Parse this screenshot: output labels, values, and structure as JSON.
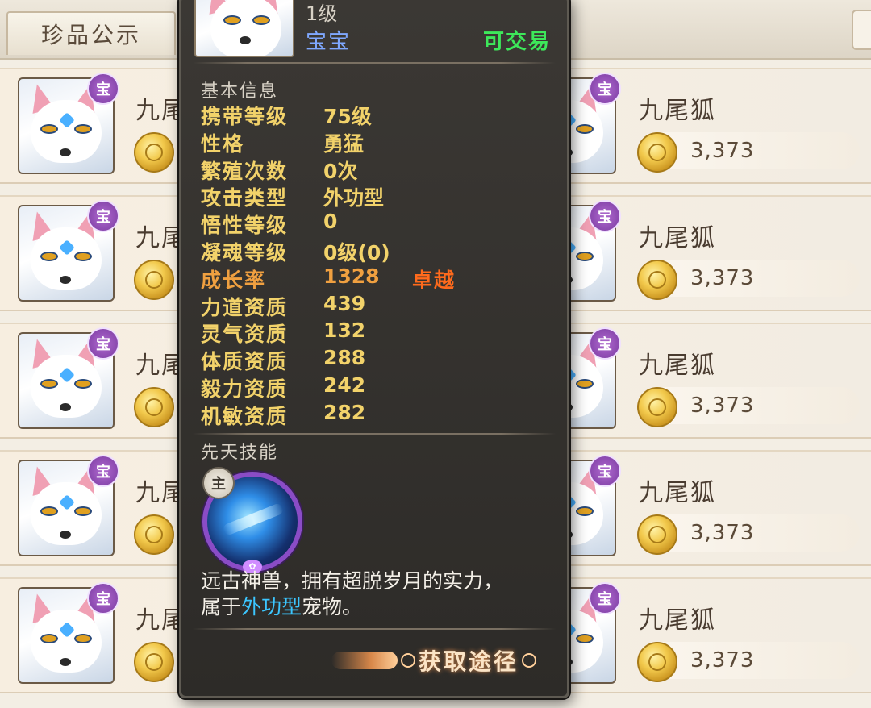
{
  "topbar": {
    "tab_label": "珍品公示"
  },
  "listings": [
    {
      "name": "九尾狐",
      "price": "3,373",
      "badge": "宝"
    },
    {
      "name": "九尾狐",
      "price": "3,373",
      "badge": "宝"
    },
    {
      "name": "九尾狐",
      "price": "3,373",
      "badge": "宝"
    },
    {
      "name": "九尾狐",
      "price": "3,373",
      "badge": "宝"
    },
    {
      "name": "九尾狐",
      "price": "3,373",
      "badge": "宝"
    }
  ],
  "left_column_name_partial": "九尾",
  "popup": {
    "level": "1级",
    "type": "宝宝",
    "tradable": "可交易",
    "basic_info_title": "基本信息",
    "stats": [
      {
        "label": "携带等级",
        "value": "75级"
      },
      {
        "label": "性格",
        "value": "勇猛"
      },
      {
        "label": "繁殖次数",
        "value": "0次"
      },
      {
        "label": "攻击类型",
        "value": "外功型"
      },
      {
        "label": "悟性等级",
        "value": "0"
      },
      {
        "label": "凝魂等级",
        "value": "0级(0)"
      },
      {
        "label": "成长率",
        "value": "1328",
        "extra": "卓越"
      },
      {
        "label": "力道资质",
        "value": "439"
      },
      {
        "label": "灵气资质",
        "value": "132"
      },
      {
        "label": "体质资质",
        "value": "288"
      },
      {
        "label": "毅力资质",
        "value": "242"
      },
      {
        "label": "机敏资质",
        "value": "282"
      }
    ],
    "innate_skill_title": "先天技能",
    "skill_badge": "主",
    "description_line1": "远古神兽，拥有超脱岁月的实力，",
    "description_prefix": "属于",
    "description_highlight": "外功型",
    "description_suffix": "宠物。",
    "obtain_label": "获取途径"
  },
  "colors": {
    "stat_text": "#f2d26a",
    "growth_text": "#f0a040",
    "excellent_tag": "#ff6a1c",
    "tradable": "#3de85a",
    "pet_type": "#7fa8ff",
    "highlight": "#3cc6ff"
  }
}
